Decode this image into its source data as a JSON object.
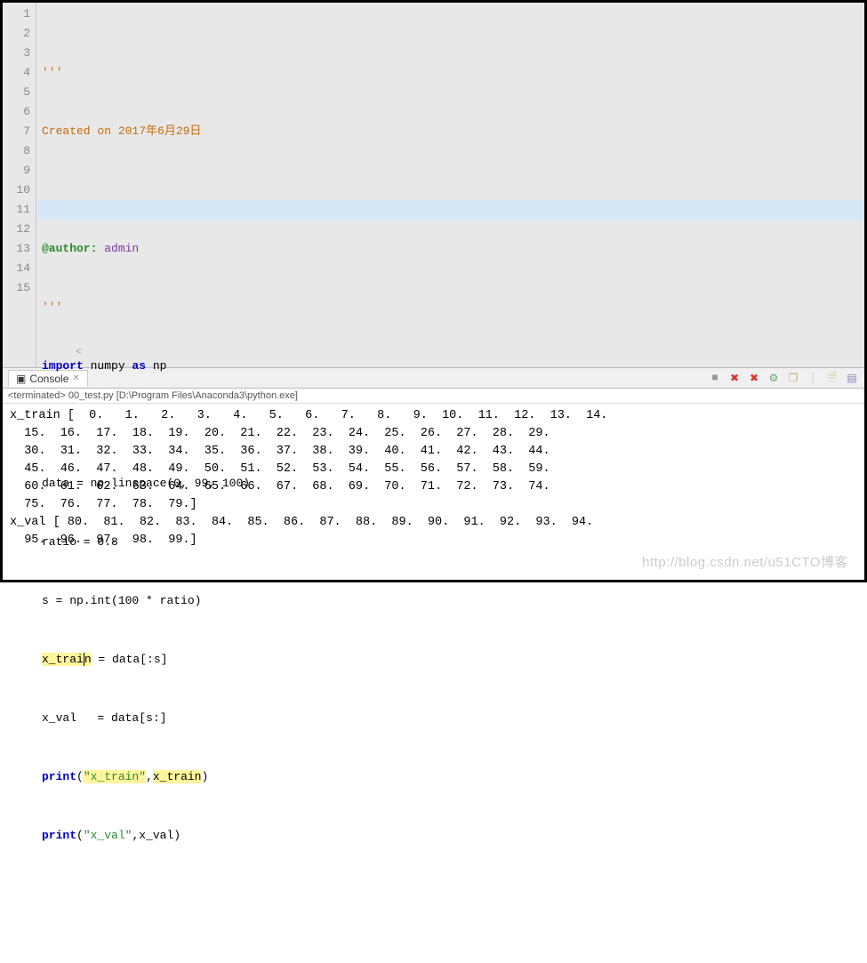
{
  "editor": {
    "lines": [
      "1",
      "2",
      "3",
      "4",
      "5",
      "6",
      "7",
      "8",
      "9",
      "10",
      "11",
      "12",
      "13",
      "14",
      "15"
    ],
    "tri_quote": "'''",
    "created": "Created on 2017年6月29日",
    "author_tag": "@author:",
    "author_name": " admin",
    "import_kw": "import",
    "numpy": " numpy ",
    "as_kw": "as",
    "np": " np",
    "l8_a": "data = np.linspace(",
    "l8_b": "0",
    "l8_c": ", ",
    "l8_d": "99",
    "l8_e": ", ",
    "l8_f": "100",
    "l8_g": ")",
    "l9_a": "ratio = ",
    "l9_b": "0.8",
    "l10_a": "s = np.int(",
    "l10_b": "100",
    "l10_c": " * ratio)",
    "l11_a": "x_trai",
    "l11_cursor": "n",
    "l11_b": " = data[:s]",
    "l12": "x_val   = data[s:]",
    "l13_a": "print",
    "l13_b": "(",
    "l13_c": "\"x_train\"",
    "l13_d": ",",
    "l13_e": "x_train",
    "l13_f": ")",
    "l14_a": "print",
    "l14_b": "(",
    "l14_c": "\"x_val\"",
    "l14_d": ",x_val)",
    "scroll_hint": "<"
  },
  "console": {
    "tab_label": "Console",
    "tab_x": "✕",
    "terminated": "<terminated> 00_test.py [D:\\Program Files\\Anaconda3\\python.exe]",
    "output": "x_train [  0.   1.   2.   3.   4.   5.   6.   7.   8.   9.  10.  11.  12.  13.  14.\n  15.  16.  17.  18.  19.  20.  21.  22.  23.  24.  25.  26.  27.  28.  29.\n  30.  31.  32.  33.  34.  35.  36.  37.  38.  39.  40.  41.  42.  43.  44.\n  45.  46.  47.  48.  49.  50.  51.  52.  53.  54.  55.  56.  57.  58.  59.\n  60.  61.  62.  63.  64.  65.  66.  67.  68.  69.  70.  71.  72.  73.  74.\n  75.  76.  77.  78.  79.]\nx_val [ 80.  81.  82.  83.  84.  85.  86.  87.  88.  89.  90.  91.  92.  93.  94.\n  95.  96.  97.  98.  99.]"
  },
  "icons": {
    "console": "▣",
    "stop": "■",
    "x1": "✖",
    "x2": "✖",
    "gear": "⚙",
    "copy": "❐",
    "sep": "|",
    "doc": "🗎",
    "grid": "▤"
  },
  "watermark": "http://blog.csdn.net/u51CTO博客"
}
